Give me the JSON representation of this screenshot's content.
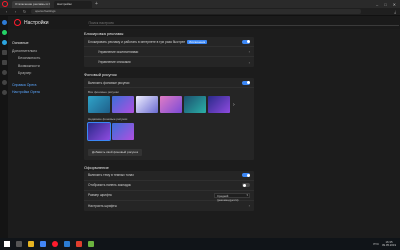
{
  "browser": {
    "tabs": [
      {
        "label": "Отключение рекламы в Оп",
        "active": false
      },
      {
        "label": "Настройки",
        "active": true
      }
    ],
    "url": "opera://settings"
  },
  "settings": {
    "title": "Настройки",
    "search_placeholder": "Поиск настроек"
  },
  "nav": {
    "items": [
      {
        "label": "Основные",
        "sub": false,
        "link": false
      },
      {
        "label": "Дополнительно",
        "sub": false,
        "link": false
      },
      {
        "label": "Безопасность",
        "sub": true,
        "link": false
      },
      {
        "label": "Возможности",
        "sub": true,
        "link": false
      },
      {
        "label": "Браузер",
        "sub": true,
        "link": false
      },
      {
        "label": "Справка Opera",
        "sub": false,
        "link": true
      },
      {
        "label": "Настройки Opera",
        "sub": false,
        "link": true
      }
    ]
  },
  "ad_block": {
    "title": "Блокировка рекламы",
    "toggle_label": "Блокировать рекламу и работать в интернете в три раза быстрее",
    "exceptions_button": "Исключения",
    "toggle_on": true,
    "rows": [
      {
        "label": "Управление исключениями"
      },
      {
        "label": "Управление списками"
      }
    ]
  },
  "wallpaper": {
    "title": "Фоновый рисунок",
    "toggle_label": "Включить фоновые рисунки",
    "toggle_on": true,
    "all_label": "Все фоновые рисунки",
    "recent_label": "Недавние фоновые рисунки",
    "add_button": "Добавить свой фоновый рисунок"
  },
  "appearance": {
    "title": "Оформление",
    "rows": [
      {
        "label": "Включить тему в темных тонах",
        "type": "toggle",
        "on": true
      },
      {
        "label": "Отобразить панель закладок",
        "type": "toggle",
        "on": false
      },
      {
        "label": "Размер шрифта",
        "type": "select",
        "value": "Средний (рекомендуется)"
      },
      {
        "label": "Настроить шрифты",
        "type": "chevron"
      }
    ]
  },
  "taskbar": {
    "time": "16:35",
    "date": "09.05.2019",
    "lang": "РУС"
  },
  "colors": {
    "accent": "#3b87f5",
    "opera_red": "#ff1b2d"
  }
}
